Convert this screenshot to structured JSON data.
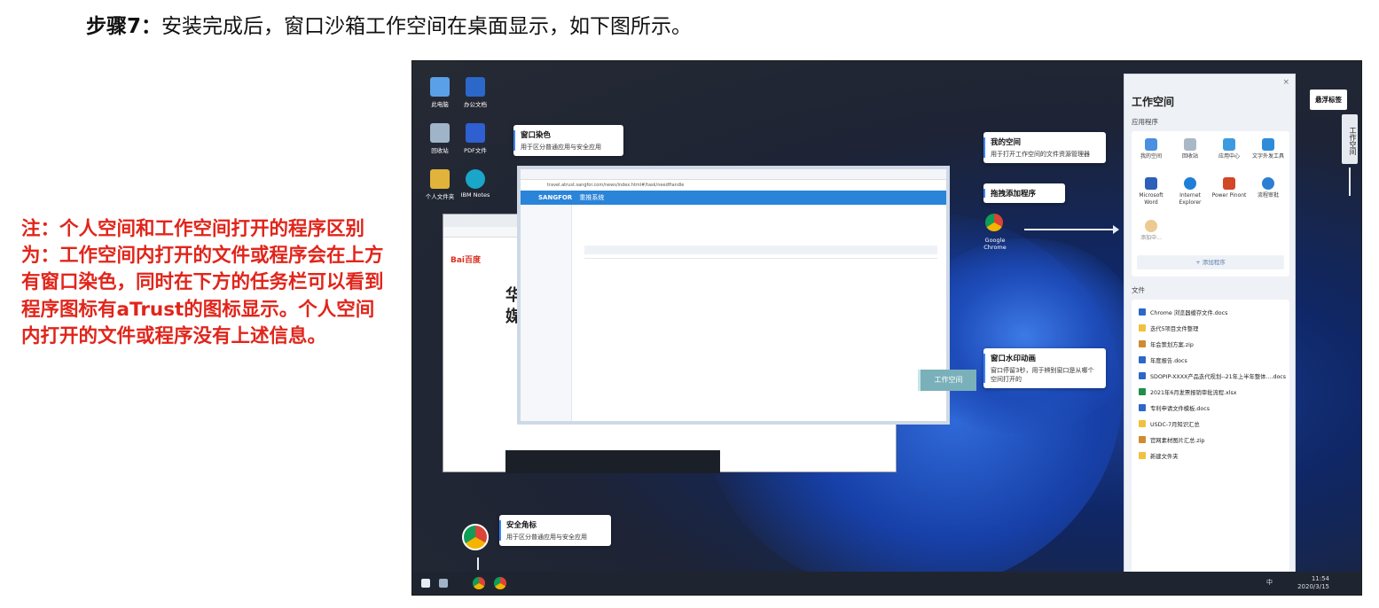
{
  "heading": {
    "step_label": "步骤7：",
    "text": "安装完成后，窗口沙箱工作空间在桌面显示，如下图所示。"
  },
  "note": {
    "text": "注：个人空间和工作空间打开的程序区别为：工作空间内打开的文件或程序会在上方有窗口染色，同时在下方的任务栏可以看到程序图标有aTrust的图标显示。个人空间内打开的文件或程序没有上述信息。"
  },
  "screenshot": {
    "desktop_icons": [
      "此电脑",
      "办公文档",
      "回收站",
      "PDF文件",
      "个人文件夹",
      "IBM Notes"
    ],
    "callouts": {
      "window_color": {
        "title": "窗口染色",
        "desc": "用于区分普通应用与安全应用"
      },
      "my_space": {
        "title": "我的空间",
        "desc": "用于打开工作空间的文件资源管理器"
      },
      "drag_add": {
        "title": "拖拽添加程序"
      },
      "watermark": {
        "title": "窗口水印动画",
        "desc": "窗口停留3秒，用于辨别窗口是从哪个空间打开的"
      },
      "secure_badge": {
        "title": "安全角标",
        "desc": "用于区分普通应用与安全应用"
      }
    },
    "dragged_app": "Google Chrome",
    "watermark_button": "工作空间",
    "float_tag": "悬浮标签",
    "side_tab": "工作空间",
    "browser_front": {
      "brand": "SANGFOR",
      "system": "重推系统",
      "url": "travel.atrust.sangfor.com/news/index.html#/task/needHandle"
    },
    "browser_back": {
      "brand": "Bai百度",
      "headline": "华 媒"
    },
    "panel": {
      "title": "工作空间",
      "apps_label": "应用程序",
      "apps": [
        "我的空间",
        "回收站",
        "应用中心",
        "文字外发工具",
        "Microsoft Word",
        "Internet Explorer",
        "Power Pinont",
        "流程审批",
        "添加中..."
      ],
      "add_button": "+ 添加程序",
      "files_label": "文件",
      "files": [
        "Chrome 浏览器缓存文件.docs",
        "迭代5项目文件整理",
        "年会策划方案.zip",
        "年度报告.docs",
        "SDOPIP-XXXX产品迭代规划--21年上半年整体....docs",
        "2021年6月发票报销审批流程.xlsx",
        "专利申请文件模板.docs",
        "USDC-7月知识汇总",
        "官网素材图片汇总.zip",
        "新建文件夹"
      ]
    },
    "tray": {
      "time": "11:54",
      "date": "2020/3/15",
      "ime": "中"
    },
    "colors": {
      "accent": "#3b82f6",
      "note_red": "#e1251b"
    }
  }
}
